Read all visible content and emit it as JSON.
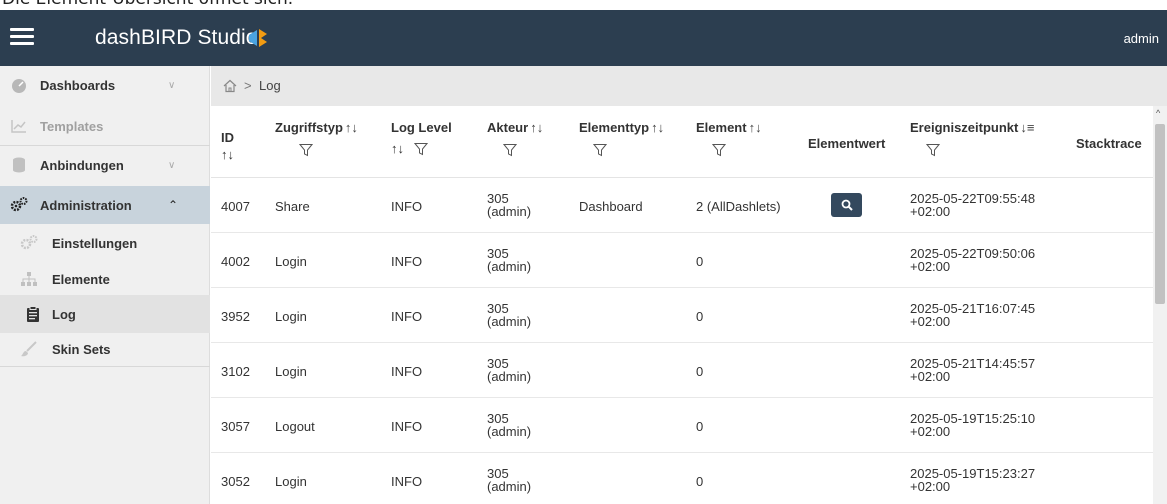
{
  "caption": "Die Element-Übersicht öffnet sich.",
  "topbar": {
    "brand": "dashBIRD Studio",
    "user": "admin"
  },
  "sidebar": {
    "items": [
      {
        "label": "Dashboards",
        "icon": "dashboard-gauge-icon"
      },
      {
        "label": "Templates",
        "icon": "chart-icon"
      },
      {
        "label": "Anbindungen",
        "icon": "database-icon"
      },
      {
        "label": "Administration",
        "icon": "gears-icon"
      },
      {
        "label": "Einstellungen",
        "icon": "gears-icon"
      },
      {
        "label": "Elemente",
        "icon": "sitemap-icon"
      },
      {
        "label": "Log",
        "icon": "clipboard-icon"
      },
      {
        "label": "Skin Sets",
        "icon": "brush-icon"
      }
    ]
  },
  "breadcrumb": {
    "page": "Log",
    "separator": ">"
  },
  "table": {
    "columns": [
      {
        "label": "ID"
      },
      {
        "label": "Zugriffstyp"
      },
      {
        "label": "Log Level"
      },
      {
        "label": "Akteur"
      },
      {
        "label": "Elementtyp"
      },
      {
        "label": "Element"
      },
      {
        "label": "Elementwert"
      },
      {
        "label": "Ereigniszeitpunkt"
      },
      {
        "label": "Stacktrace"
      }
    ],
    "rows": [
      {
        "id": "4007",
        "type": "Share",
        "level": "INFO",
        "actor1": "305",
        "actor2": "(admin)",
        "elementtype": "Dashboard",
        "element": "2 (AllDashlets)",
        "date": "2025-05-22T09:55:48",
        "tz": "+02:00",
        "has_value": true
      },
      {
        "id": "4002",
        "type": "Login",
        "level": "INFO",
        "actor1": "305",
        "actor2": "(admin)",
        "elementtype": "",
        "element": "0",
        "date": "2025-05-22T09:50:06",
        "tz": "+02:00"
      },
      {
        "id": "3952",
        "type": "Login",
        "level": "INFO",
        "actor1": "305",
        "actor2": "(admin)",
        "elementtype": "",
        "element": "0",
        "date": "2025-05-21T16:07:45",
        "tz": "+02:00"
      },
      {
        "id": "3102",
        "type": "Login",
        "level": "INFO",
        "actor1": "305",
        "actor2": "(admin)",
        "elementtype": "",
        "element": "0",
        "date": "2025-05-21T14:45:57",
        "tz": "+02:00"
      },
      {
        "id": "3057",
        "type": "Logout",
        "level": "INFO",
        "actor1": "305",
        "actor2": "(admin)",
        "elementtype": "",
        "element": "0",
        "date": "2025-05-19T15:25:10",
        "tz": "+02:00"
      },
      {
        "id": "3052",
        "type": "Login",
        "level": "INFO",
        "actor1": "305",
        "actor2": "(admin)",
        "elementtype": "",
        "element": "0",
        "date": "2025-05-19T15:23:27",
        "tz": "+02:00"
      }
    ]
  },
  "colors": {
    "topbar": "#2c3e50",
    "active_menu": "#c8d3dc",
    "button": "#34495e"
  }
}
